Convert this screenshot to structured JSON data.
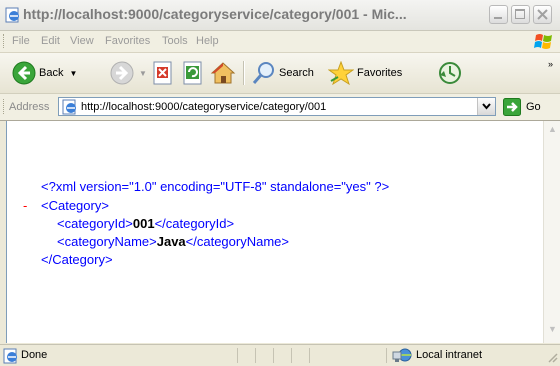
{
  "window": {
    "title": "http://localhost:9000/categoryservice/category/001 - Mic..."
  },
  "menu": {
    "items": [
      "File",
      "Edit",
      "View",
      "Favorites",
      "Tools",
      "Help"
    ]
  },
  "toolbar": {
    "back_label": "Back",
    "search_label": "Search",
    "favorites_label": "Favorites"
  },
  "address": {
    "label": "Address",
    "url": "http://localhost:9000/categoryservice/category/001",
    "go_label": "Go"
  },
  "document": {
    "declaration": "<?xml version=\"1.0\" encoding=\"UTF-8\" standalone=\"yes\" ?>",
    "collapse_marker": "-",
    "root_open": "<Category>",
    "root_close": "</Category>",
    "fields": [
      {
        "open": "<categoryId>",
        "value": "001",
        "close": "</categoryId>"
      },
      {
        "open": "<categoryName>",
        "value": "Java",
        "close": "</categoryName>"
      }
    ]
  },
  "status": {
    "text": "Done",
    "zone": "Local intranet"
  },
  "colors": {
    "xml_tag": "#0000ff",
    "collapse_marker": "#ff0000",
    "value": "#000000"
  }
}
